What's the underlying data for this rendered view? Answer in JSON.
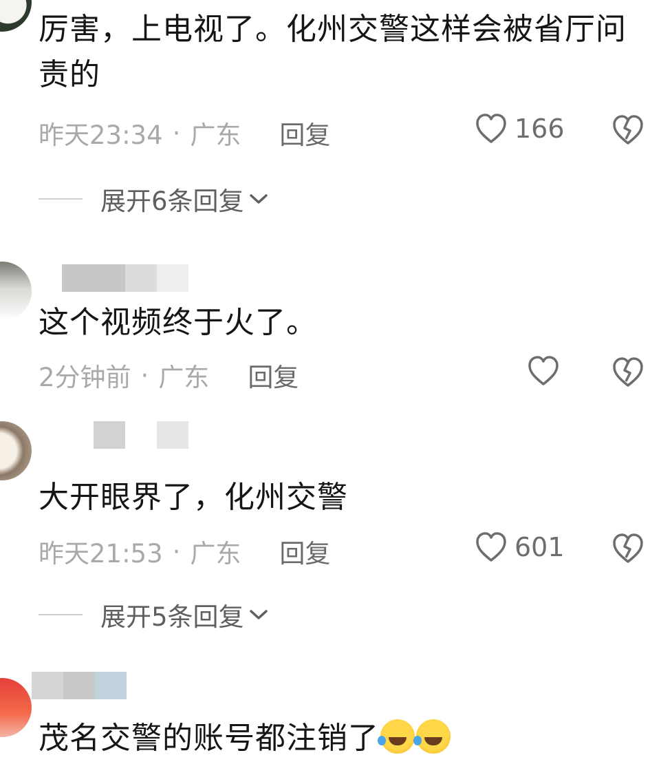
{
  "comments": [
    {
      "text": "厉害，上电视了。化州交警这样会被省厅问责的",
      "time": "昨天23:34",
      "dot": "·",
      "location": "广东",
      "reply": "回复",
      "likes": "166",
      "expand": "展开6条回复"
    },
    {
      "text": "这个视频终于火了。",
      "time": "2分钟前",
      "dot": "·",
      "location": "广东",
      "reply": "回复",
      "likes": ""
    },
    {
      "text": "大开眼界了，化州交警",
      "time": "昨天21:53",
      "dot": "·",
      "location": "广东",
      "reply": "回复",
      "likes": "601",
      "expand": "展开5条回复"
    },
    {
      "text": "茂名交警的账号都注销了"
    }
  ],
  "icons": {
    "like": "heart-outline-icon",
    "dislike": "broken-heart-icon",
    "expand": "chevron-down-icon",
    "emoji": "rofl-emoji-icon"
  }
}
